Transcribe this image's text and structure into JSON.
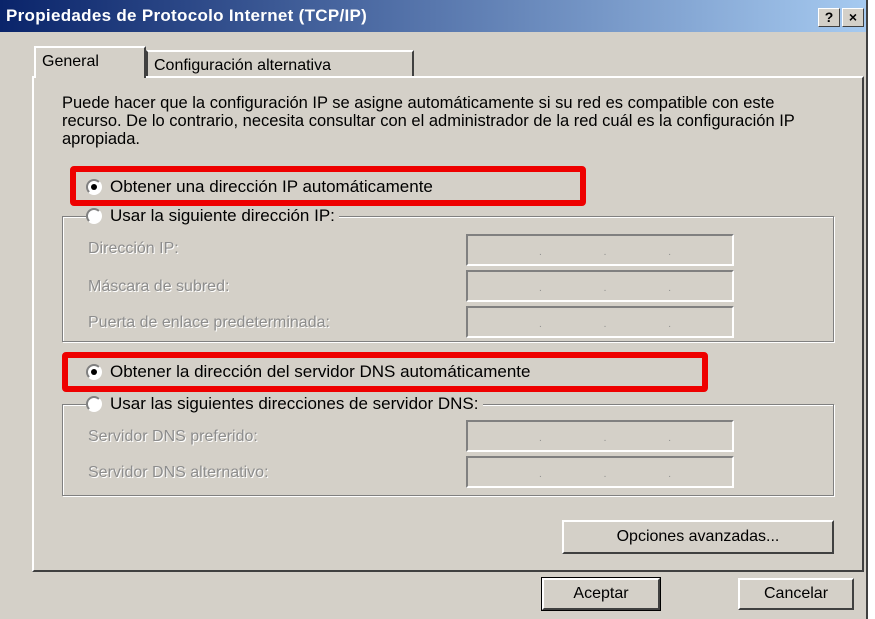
{
  "window": {
    "title": "Propiedades de Protocolo Internet (TCP/IP)",
    "help_button": "?",
    "close_button": "×"
  },
  "tabs": [
    {
      "label": "General",
      "selected": true
    },
    {
      "label": "Configuración alternativa",
      "selected": false
    }
  ],
  "description": "Puede hacer que la configuración IP se asigne automáticamente si su red es compatible con este recurso. De lo contrario, necesita consultar con el administrador de la red cuál es la configuración IP apropiada.",
  "ip_section": {
    "auto_label": "Obtener una dirección IP automáticamente",
    "auto_selected": true,
    "manual_label": "Usar la siguiente dirección IP:",
    "manual_selected": false,
    "fields": [
      {
        "label": "Dirección IP:",
        "value": ". . ."
      },
      {
        "label": "Máscara de subred:",
        "value": ". . ."
      },
      {
        "label": "Puerta de enlace predeterminada:",
        "value": ". . ."
      }
    ]
  },
  "dns_section": {
    "auto_label": "Obtener la dirección del servidor DNS automáticamente",
    "auto_selected": true,
    "manual_label": "Usar las siguientes direcciones de servidor DNS:",
    "manual_selected": false,
    "fields": [
      {
        "label": "Servidor DNS preferido:",
        "value": ". . ."
      },
      {
        "label": "Servidor DNS alternativo:",
        "value": ". . ."
      }
    ]
  },
  "buttons": {
    "advanced": "Opciones avanzadas...",
    "ok": "Aceptar",
    "cancel": "Cancelar"
  },
  "colors": {
    "title_gradient_start": "#0a246a",
    "title_gradient_end": "#a6caf0",
    "dialog_face": "#d4d0c8",
    "highlight": "#ee0000"
  }
}
